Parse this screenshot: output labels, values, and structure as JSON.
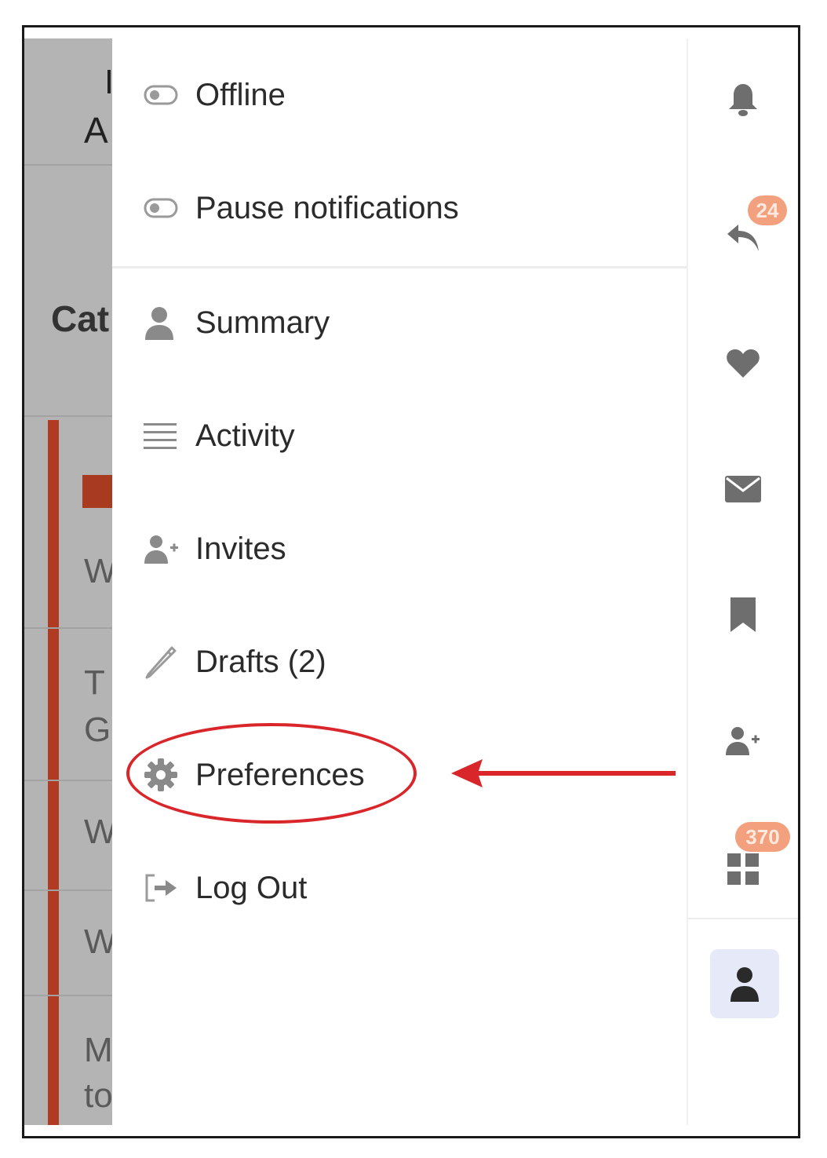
{
  "background_page": {
    "fragments": [
      "A",
      "Cat",
      "W",
      "T",
      "G",
      "W",
      "W",
      "M",
      "to"
    ]
  },
  "menu": {
    "status_items": [
      {
        "label": "Offline",
        "icon": "toggle-off-icon"
      },
      {
        "label": "Pause notifications",
        "icon": "toggle-off-icon"
      }
    ],
    "items": [
      {
        "label": "Summary",
        "icon": "user-icon"
      },
      {
        "label": "Activity",
        "icon": "list-icon"
      },
      {
        "label": "Invites",
        "icon": "user-plus-icon"
      },
      {
        "label": "Drafts (2)",
        "icon": "pencil-icon"
      },
      {
        "label": "Preferences",
        "icon": "gear-icon",
        "highlighted": true
      },
      {
        "label": "Log Out",
        "icon": "sign-out-icon"
      }
    ]
  },
  "rail": {
    "icons": [
      "bell-icon",
      "reply-icon",
      "heart-icon",
      "envelope-icon",
      "bookmark-icon",
      "user-plus-icon",
      "grid-icon",
      "user-icon"
    ],
    "reply_badge": "24",
    "grid_badge": "370"
  },
  "colors": {
    "annotation_red": "#d9262b",
    "badge": "#f2a07d",
    "active_avatar_bg": "#e6e9f7",
    "icon_gray": "#6e6e6e"
  }
}
